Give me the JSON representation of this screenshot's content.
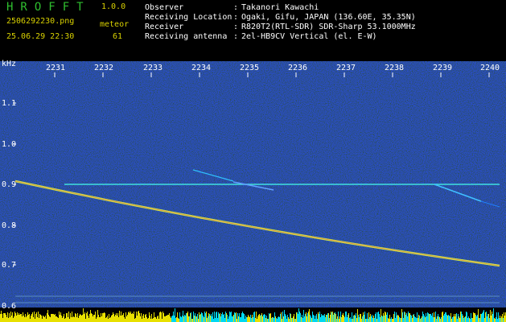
{
  "header": {
    "app_title": "HROFFT",
    "version": "1.0.0",
    "filename": "2506292230.png",
    "mode": "meteor",
    "datetime": "25.06.29 22:30",
    "count": "61"
  },
  "info": [
    {
      "key": "Observer",
      "value": "Takanori Kawachi"
    },
    {
      "key": "Receiving Location",
      "value": "Ogaki, Gifu, JAPAN (136.60E, 35.35N)"
    },
    {
      "key": "Receiver",
      "value": "R820T2(RTL-SDR) SDR-Sharp 53.1000MHz"
    },
    {
      "key": "Receiving antenna",
      "value": "2el-HB9CV Vertical (el. E-W)"
    }
  ],
  "separator": ":",
  "axis": {
    "y_unit": "kHz",
    "y_ticks": [
      "1.1",
      "1.0",
      "0.9",
      "0.8",
      "0.7",
      "0.6"
    ],
    "x_ticks": [
      "2231",
      "2232",
      "2233",
      "2234",
      "2235",
      "2236",
      "2237",
      "2238",
      "2239",
      "2240"
    ]
  },
  "colors": {
    "background": "#000000",
    "noise_blue": "#0a1a8c",
    "title_green": "#2fbf2f",
    "label_yellow": "#d8d000",
    "text_white": "#ffffff",
    "carrier_cyan": "#40e0e0",
    "level_yellow": "#e8e000",
    "level_cyan": "#00d8f0"
  }
}
